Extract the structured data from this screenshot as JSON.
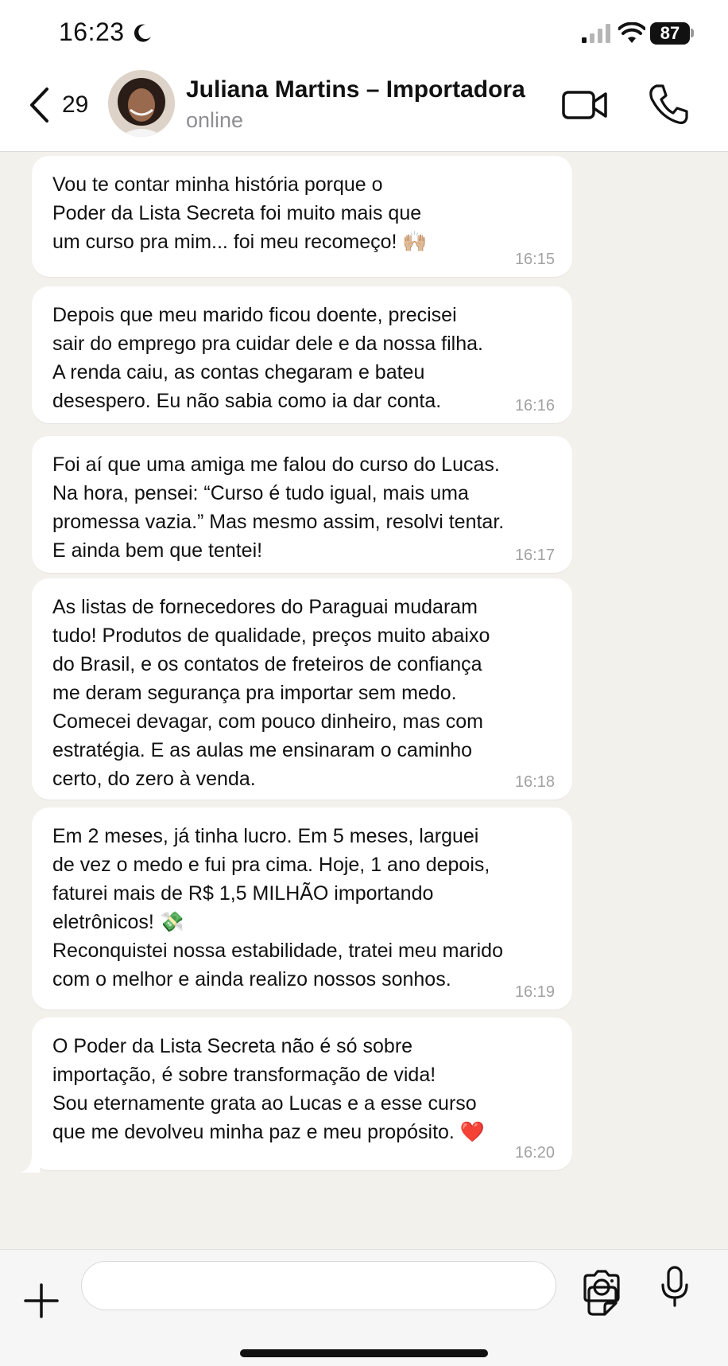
{
  "status_bar": {
    "time": "16:23",
    "battery": "87"
  },
  "header": {
    "back_count": "29",
    "contact_name": "Juliana Martins – Importadora",
    "contact_status": "online"
  },
  "messages": [
    {
      "text": "Vou te contar minha história porque o\nPoder da Lista Secreta foi muito mais que\num curso pra mim... foi meu recomeço! 🙌🏼",
      "time": "16:15"
    },
    {
      "text": "Depois que meu marido ficou doente, precisei\nsair do emprego pra cuidar dele e da nossa filha.\nA renda caiu, as contas chegaram e bateu\ndesespero. Eu não sabia como ia dar conta.",
      "time": "16:16"
    },
    {
      "text": "Foi aí que uma amiga me falou do curso do Lucas.\nNa hora, pensei: “Curso é tudo igual, mais uma\npromessa vazia.” Mas mesmo assim, resolvi tentar.\nE ainda bem que tentei!",
      "time": "16:17"
    },
    {
      "text": "As listas de fornecedores do Paraguai mudaram\ntudo! Produtos de qualidade, preços muito abaixo\ndo Brasil, e os contatos de freteiros de confiança\nme deram segurança pra importar sem medo.\nComecei devagar, com pouco dinheiro, mas com\nestratégia. E as aulas me ensinaram o caminho\ncerto, do zero à venda.",
      "time": "16:18"
    },
    {
      "text": "Em 2 meses, já tinha lucro. Em 5 meses, larguei\nde vez o medo e fui pra cima. Hoje, 1 ano depois,\nfaturei mais de R$ 1,5 MILHÃO importando\neletrônicos! 💸\nReconquistei nossa estabilidade, tratei meu marido\ncom o melhor e ainda realizo nossos sonhos.",
      "time": "16:19"
    },
    {
      "text": "O Poder da Lista Secreta não é só sobre\nimportação, é sobre transformação de vida!\nSou eternamente grata ao Lucas e a esse curso\nque me devolveu minha paz e meu propósito. ❤️",
      "time": "16:20"
    }
  ],
  "composer": {
    "placeholder": ""
  },
  "colors": {
    "bubble": "#ffffff",
    "chat_background": "#f3f1ec",
    "timestamp": "#a2a2a2"
  }
}
